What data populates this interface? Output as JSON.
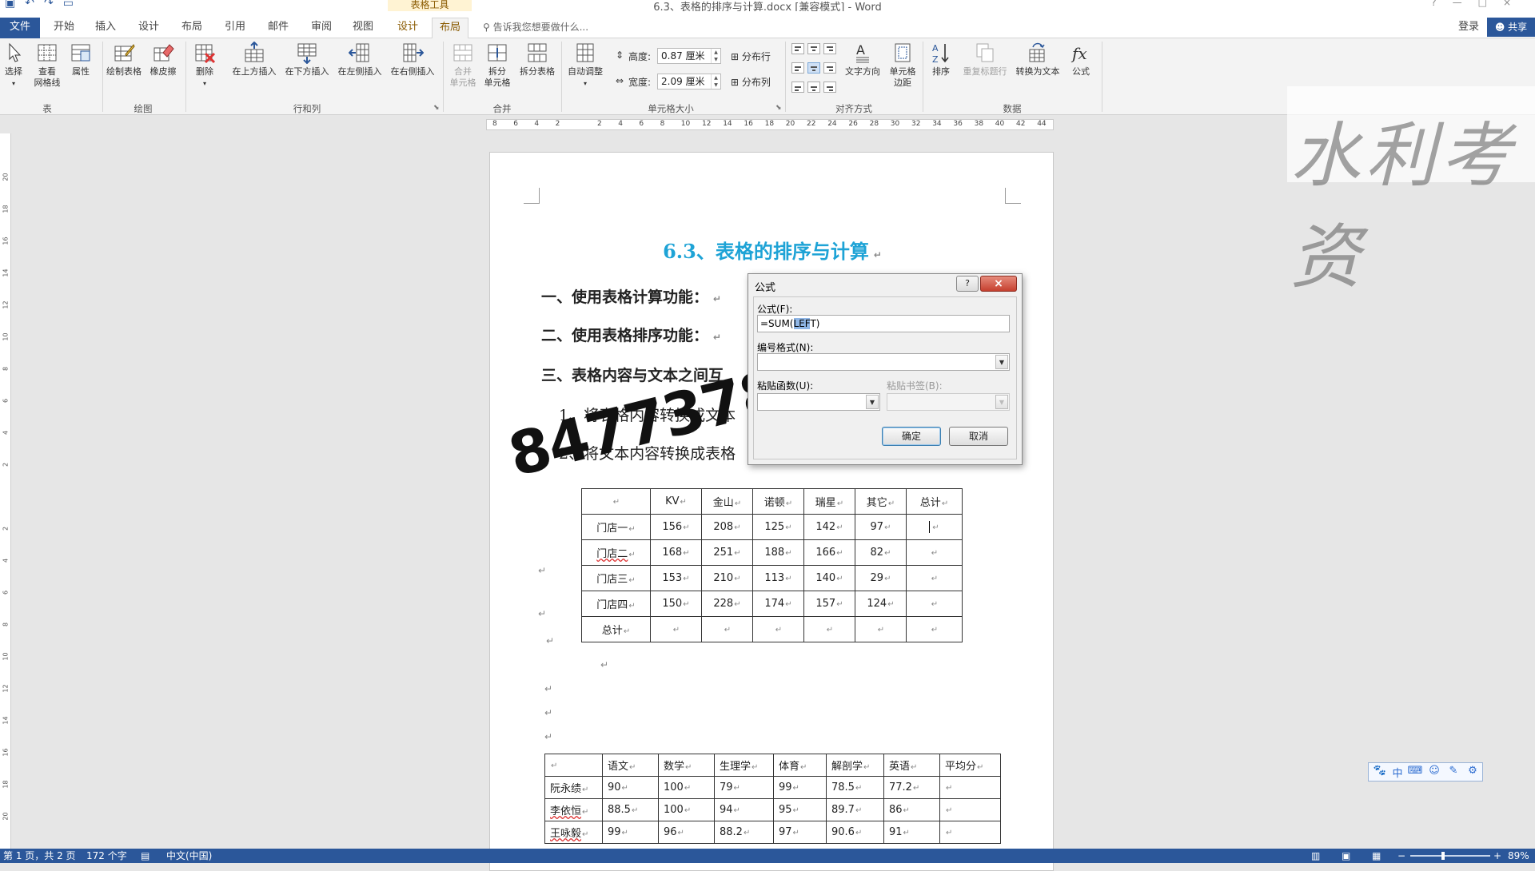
{
  "window": {
    "doc_title": "6.3、表格的排序与计算.docx [兼容模式] - Word",
    "context_tab_group": "表格工具",
    "quick_access": [
      "save-icon",
      "undo-icon",
      "redo-icon",
      "open-icon"
    ],
    "controls": [
      "?",
      "—",
      "□",
      "×"
    ]
  },
  "tabs": {
    "file": "文件",
    "home": "开始",
    "insert": "插入",
    "design": "设计",
    "layout": "布局",
    "references": "引用",
    "mailings": "邮件",
    "review": "审阅",
    "view": "视图",
    "table_design": "设计",
    "table_layout": "布局",
    "tell_me": "告诉我您想要做什么...",
    "signin": "登录",
    "share": "共享"
  },
  "ribbon": {
    "select": "选择",
    "gridlines_1": "查看",
    "gridlines_2": "网格线",
    "properties": "属性",
    "draw_table": "绘制表格",
    "eraser": "橡皮擦",
    "delete": "删除",
    "insert_above": "在上方插入",
    "insert_below": "在下方插入",
    "insert_left": "在左侧插入",
    "insert_right": "在右侧插入",
    "merge_cells_1": "合并",
    "merge_cells_2": "单元格",
    "split_cells_1": "拆分",
    "split_cells_2": "单元格",
    "split_table": "拆分表格",
    "autofit": "自动调整",
    "height_label": "高度:",
    "height_value": "0.87 厘米",
    "width_label": "宽度:",
    "width_value": "2.09 厘米",
    "distribute_rows": "分布行",
    "distribute_cols": "分布列",
    "text_direction": "文字方向",
    "cell_margins_1": "单元格",
    "cell_margins_2": "边距",
    "sort": "排序",
    "repeat_header": "重复标题行",
    "convert_to_text": "转换为文本",
    "formula": "公式",
    "groups": {
      "table": "表",
      "draw": "绘图",
      "rows_cols": "行和列",
      "merge": "合并",
      "cell_size": "单元格大小",
      "alignment": "对齐方式",
      "data": "数据"
    }
  },
  "ruler": {
    "h_ticks": [
      "8",
      "6",
      "4",
      "2",
      "",
      "2",
      "4",
      "6",
      "8",
      "10",
      "12",
      "14",
      "16",
      "18",
      "20",
      "22",
      "24",
      "26",
      "28",
      "30",
      "32",
      "34",
      "36",
      "38",
      "40",
      "42",
      "44"
    ],
    "v_ticks": [
      "20",
      "18",
      "16",
      "14",
      "12",
      "10",
      "8",
      "6",
      "4",
      "2",
      "",
      "2",
      "4",
      "6",
      "8",
      "10",
      "12",
      "14",
      "16",
      "18",
      "20"
    ]
  },
  "document": {
    "heading": "6.3、表格的排序与计算",
    "p1": "一、使用表格计算功能：",
    "p2": "二、使用表格排序功能：",
    "p3": "三、表格内容与文本之间互",
    "p4": "1、将表格内容转换成文本",
    "p5": "2、将文本内容转换成表格",
    "table1": {
      "headers": [
        "",
        "KV",
        "金山",
        "诺顿",
        "瑞星",
        "其它",
        "总计"
      ],
      "rows": [
        [
          "门店一",
          "156",
          "208",
          "125",
          "142",
          "97",
          ""
        ],
        [
          "门店二",
          "168",
          "251",
          "188",
          "166",
          "82",
          ""
        ],
        [
          "门店三",
          "153",
          "210",
          "113",
          "140",
          "29",
          ""
        ],
        [
          "门店四",
          "150",
          "228",
          "174",
          "157",
          "124",
          ""
        ],
        [
          "总计",
          "",
          "",
          "",
          "",
          "",
          ""
        ]
      ]
    },
    "table2": {
      "headers": [
        "",
        "语文",
        "数学",
        "生理学",
        "体育",
        "解剖学",
        "英语",
        "平均分"
      ],
      "rows": [
        [
          "阮永绩",
          "90",
          "100",
          "79",
          "99",
          "78.5",
          "77.2",
          ""
        ],
        [
          "李依恒",
          "88.5",
          "100",
          "94",
          "95",
          "89.7",
          "86",
          ""
        ],
        [
          "王咏毅",
          "99",
          "96",
          "88.2",
          "97",
          "90.6",
          "91",
          ""
        ]
      ]
    },
    "handwriting": "84773784",
    "watermark": "水利考资"
  },
  "dialog": {
    "title": "公式",
    "help": "?",
    "close": "×",
    "formula_label": "公式(F):",
    "formula_value_prefix": "=SUM(",
    "formula_value_selected": "LEF",
    "formula_value_suffix": "T)",
    "number_format_label": "编号格式(N):",
    "number_format_value": "",
    "paste_function_label": "粘贴函数(U):",
    "paste_function_value": "",
    "paste_bookmark_label": "粘贴书签(B):",
    "paste_bookmark_value": "",
    "ok": "确定",
    "cancel": "取消"
  },
  "ime": [
    "paw-icon",
    "中",
    "keyboard-icon",
    "emoji-icon",
    "pen-icon",
    "settings-icon"
  ],
  "status": {
    "page": "第 1 页，共 2 页",
    "words": "172 个字",
    "language": "中文(中国)",
    "zoom": "89%"
  },
  "colors": {
    "accent": "#2b579a",
    "heading": "#1ea3d6",
    "context_tab": "#fff3d3",
    "dialog_close": "#c6402f"
  }
}
